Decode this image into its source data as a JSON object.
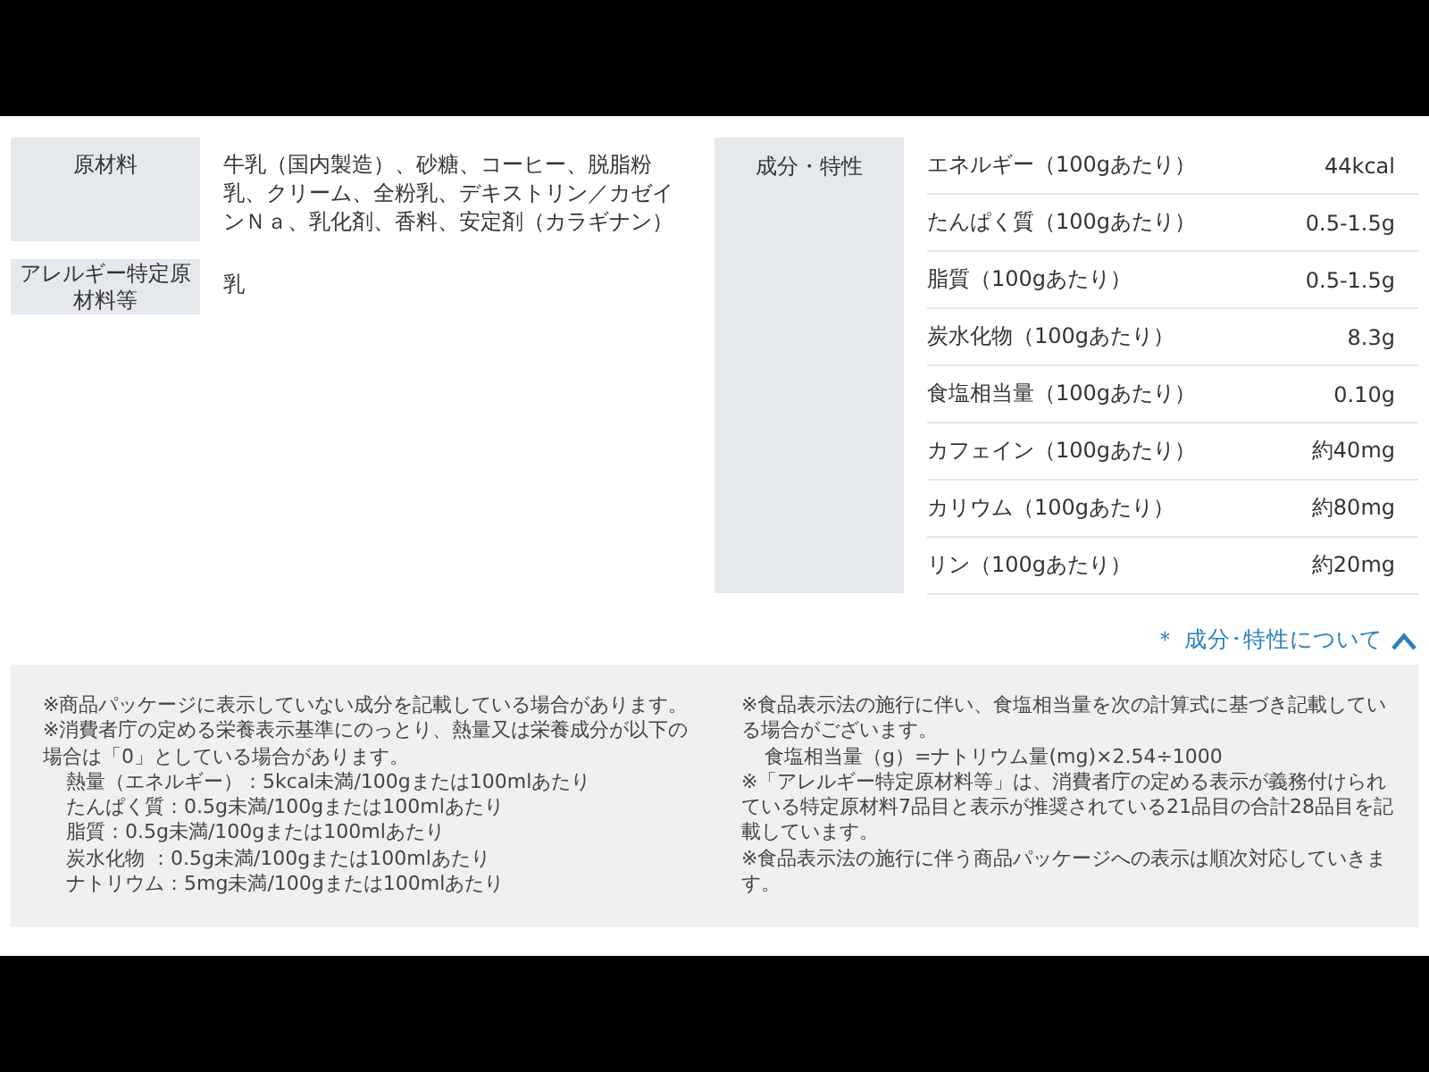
{
  "ingredients": [
    {
      "label": "原材料",
      "value": "牛乳（国内製造）、砂糖、コーヒー、脱脂粉乳、クリーム、全粉乳、デキストリン／カゼインＮａ、乳化剤、香料、安定剤（カラギナン）"
    },
    {
      "label": "アレルギー特定原材料等",
      "value": "乳"
    }
  ],
  "nutrition": {
    "label": "成分・特性",
    "rows": [
      {
        "name": "エネルギー（100gあたり）",
        "value": "44kcal"
      },
      {
        "name": "たんぱく質（100gあたり）",
        "value": "0.5-1.5g"
      },
      {
        "name": "脂質（100gあたり）",
        "value": "0.5-1.5g"
      },
      {
        "name": "炭水化物（100gあたり）",
        "value": "8.3g"
      },
      {
        "name": "食塩相当量（100gあたり）",
        "value": "0.10g"
      },
      {
        "name": "カフェイン（100gあたり）",
        "value": "約40mg"
      },
      {
        "name": "カリウム（100gあたり）",
        "value": "約80mg"
      },
      {
        "name": "リン（100gあたり）",
        "value": "約20mg"
      }
    ]
  },
  "toggle": {
    "mark": "＊",
    "label": "成分･特性について",
    "expanded": true
  },
  "notes": [
    [
      {
        "kind": "note",
        "text": "※商品パッケージに表示していない成分を記載している場合があります。"
      },
      {
        "kind": "note",
        "text": "※消費者庁の定める栄養表示基準にのっとり、熱量又は栄養成分が以下の場合は「0」としている場合があります。"
      },
      {
        "kind": "indent",
        "text": "熱量（エネルギー）：5kcal未満/100gまたは100mlあたり"
      },
      {
        "kind": "indent",
        "text": "たんぱく質：0.5g未満/100gまたは100mlあたり"
      },
      {
        "kind": "indent",
        "text": "脂質：0.5g未満/100gまたは100mlあたり"
      },
      {
        "kind": "indent",
        "text": "炭水化物 ：0.5g未満/100gまたは100mlあたり"
      },
      {
        "kind": "indent",
        "text": "ナトリウム：5mg未満/100gまたは100mlあたり"
      }
    ],
    [
      {
        "kind": "note",
        "text": "※食品表示法の施行に伴い、食塩相当量を次の計算式に基づき記載している場合がございます。"
      },
      {
        "kind": "indent",
        "text": "食塩相当量（g）=ナトリウム量(mg)×2.54÷1000"
      },
      {
        "kind": "note",
        "text": "※「アレルギー特定原材料等」は、消費者庁の定める表示が義務付けられている特定原材料7品目と表示が推奨されている21品目の合計28品目を記載しています。"
      },
      {
        "kind": "note",
        "text": "※食品表示法の施行に伴う商品パッケージへの表示は順次対応していきます。"
      }
    ]
  ]
}
